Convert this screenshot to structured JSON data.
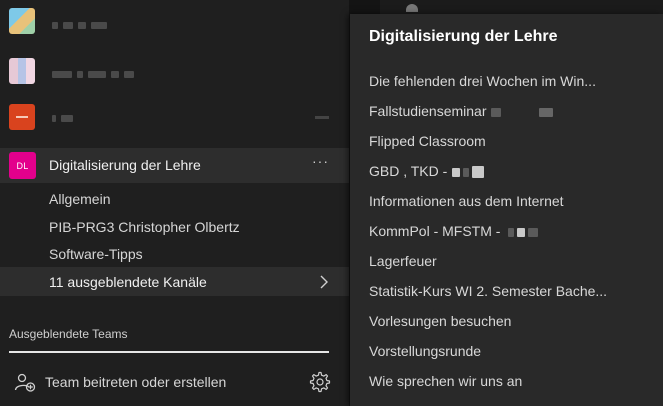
{
  "sidebar": {
    "teams": [
      {
        "name": "",
        "avatar_color": "#5fa8d3"
      },
      {
        "name": "",
        "avatar_color": "#c9b2d6"
      },
      {
        "name": "",
        "avatar_color": "#d9431e"
      }
    ],
    "active_team": {
      "initials": "DL",
      "name": "Digitalisierung der Lehre",
      "more": "···",
      "avatar_color": "#e3008c",
      "channels": [
        "Allgemein",
        "PIB-PRG3 Christopher Olbertz",
        "Software-Tipps"
      ],
      "hidden_channels": "11 ausgeblendete Kanäle"
    },
    "hidden_teams_label": "Ausgeblendete Teams",
    "join_label": "Team beitreten oder erstellen",
    "icons": {
      "join": "team-add-icon",
      "settings": "gear-icon",
      "chevron": "chevron-right-icon"
    }
  },
  "flyout": {
    "title": "Digitalisierung der Lehre",
    "items": [
      "Die fehlenden drei Wochen im Win...",
      "Fallstudienseminar",
      "Flipped Classroom",
      "GBD , TKD -",
      "Informationen aus dem Internet",
      "KommPol - MFSTM -",
      "Lagerfeuer",
      "Statistik-Kurs WI 2. Semester Bache...",
      "Vorlesungen besuchen",
      "Vorstellungsrunde",
      "Wie sprechen wir uns an"
    ]
  }
}
